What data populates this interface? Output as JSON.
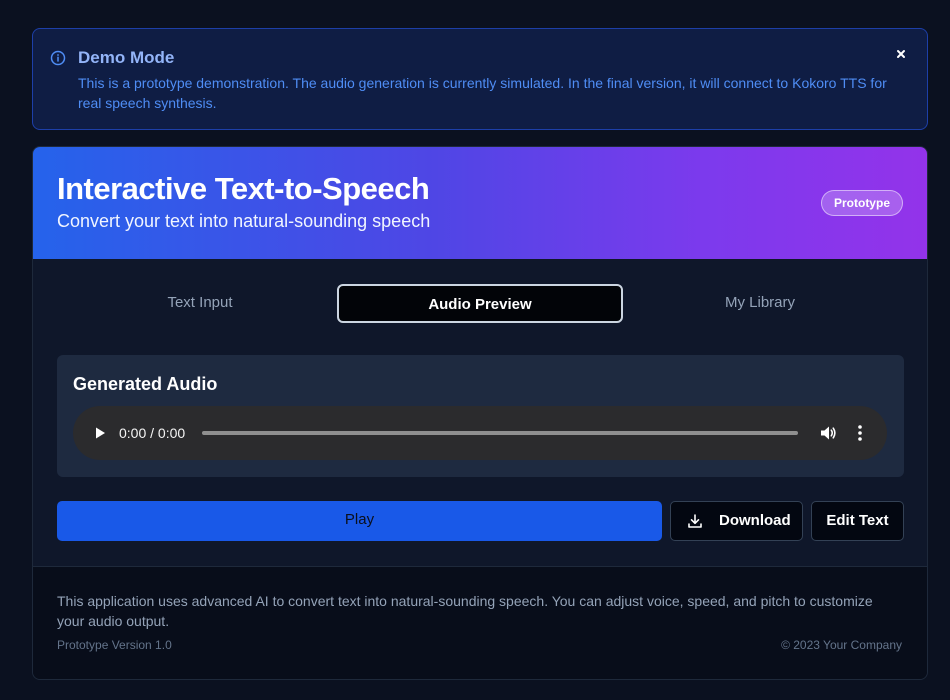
{
  "alert": {
    "icon": "info-icon",
    "title": "Demo Mode",
    "message": "This is a prototype demonstration. The audio generation is currently simulated. In the final version, it will connect to Kokoro TTS for real speech synthesis.",
    "close_icon": "close-icon"
  },
  "header": {
    "title": "Interactive Text-to-Speech",
    "subtitle": "Convert your text into natural-sounding speech",
    "badge": "Prototype"
  },
  "tabs": [
    {
      "label": "Text Input",
      "active": false
    },
    {
      "label": "Audio Preview",
      "active": true
    },
    {
      "label": "My Library",
      "active": false
    }
  ],
  "audio": {
    "heading": "Generated Audio",
    "time": "0:00 / 0:00",
    "progress": 0
  },
  "actions": {
    "play_label": "Play",
    "download_label": "Download",
    "edit_label": "Edit Text"
  },
  "footer": {
    "description": "This application uses advanced AI to convert text into natural-sounding speech. You can adjust voice, speed, and pitch to customize your audio output.",
    "version": "Prototype Version 1.0",
    "copyright": "© 2023 Your Company"
  },
  "colors": {
    "primary": "#1959e8",
    "gradient_start": "#2563eb",
    "gradient_end": "#9333ea",
    "alert_text": "#4f8df5"
  }
}
